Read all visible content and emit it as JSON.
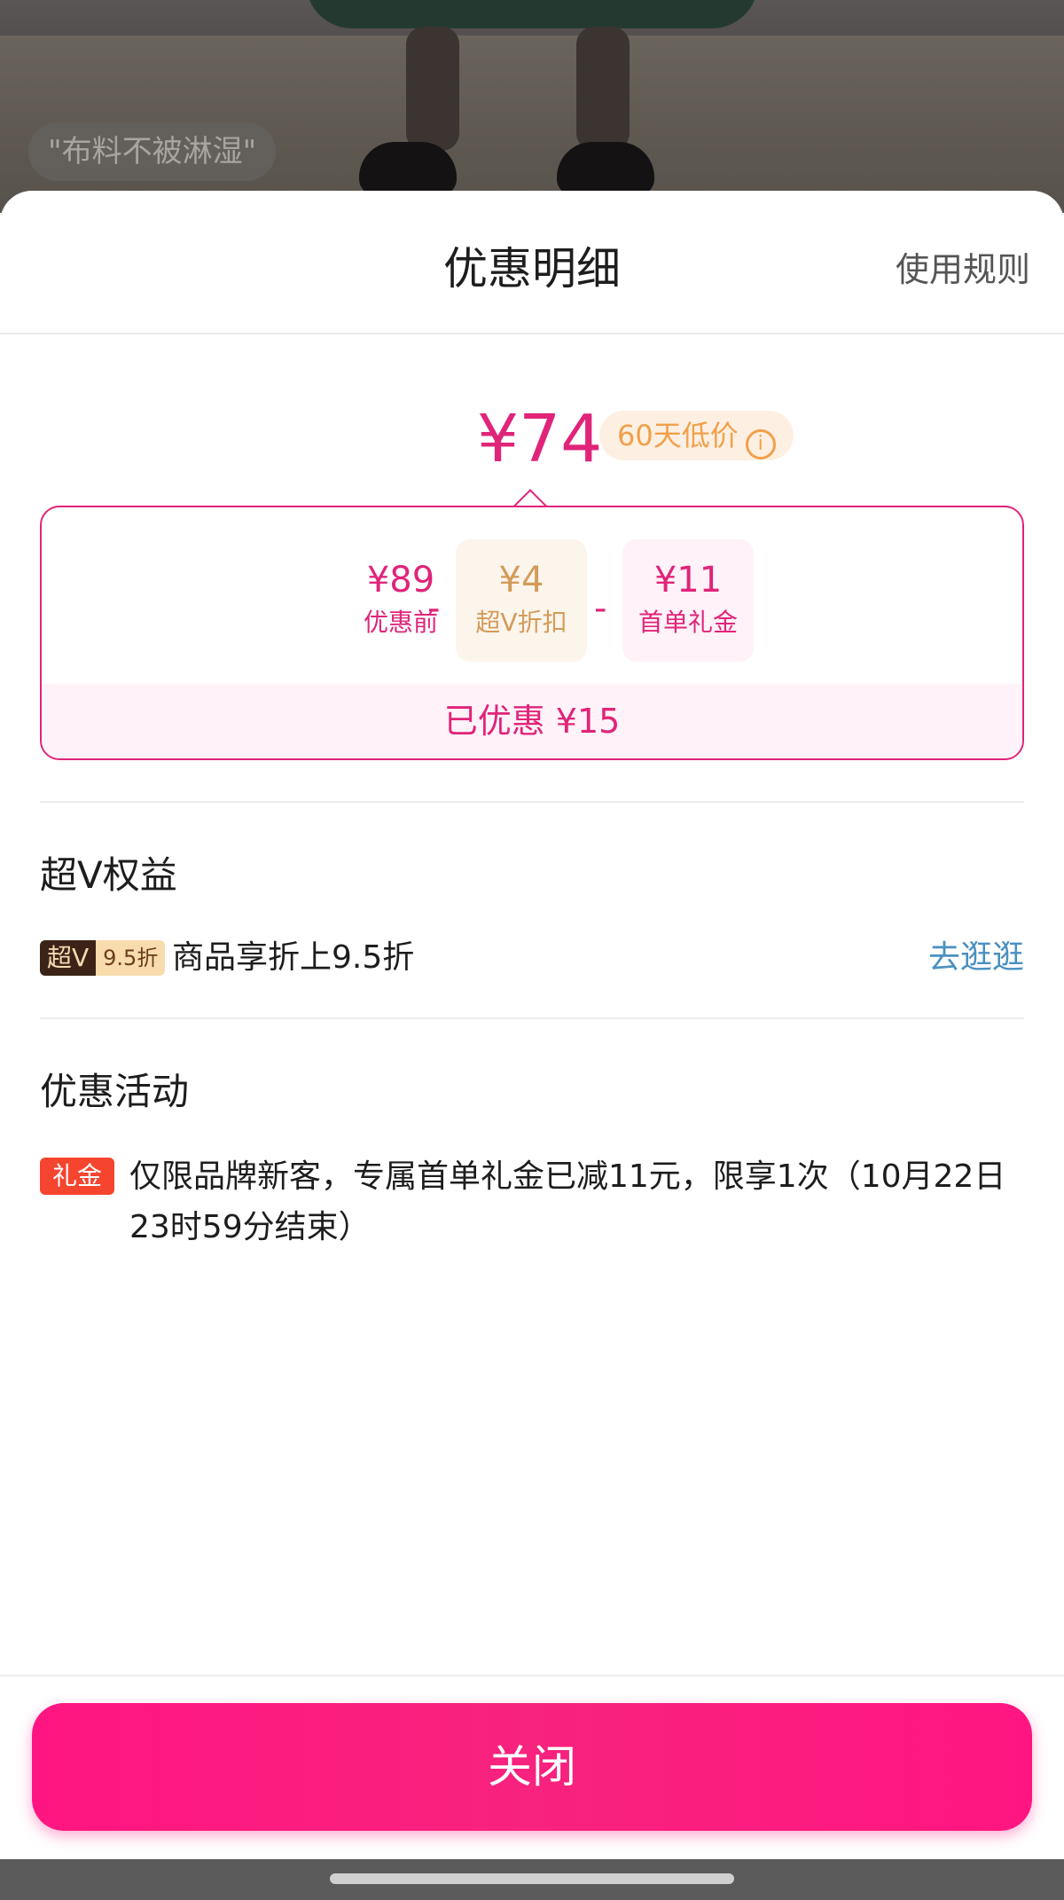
{
  "background": {
    "tag_text": "\"布料不被淋湿\""
  },
  "sheet": {
    "title": "优惠明细",
    "rules_label": "使用规则",
    "final_price": "¥74",
    "low_price_badge": "60天低价",
    "info_glyph": "i",
    "calculation": {
      "base": {
        "value": "¥89",
        "label": "优惠前"
      },
      "op1": "-",
      "superv_discount": {
        "value": "¥4",
        "label": "超V折扣"
      },
      "op2": "-",
      "first_order_gift": {
        "value": "¥11",
        "label": "首单礼金"
      },
      "total_saved": "已优惠 ¥15"
    },
    "superv_section": {
      "title": "超V权益",
      "badge_left": "超V",
      "badge_right": "9.5折",
      "description": "商品享折上9.5折",
      "link": "去逛逛"
    },
    "promotion_section": {
      "title": "优惠活动",
      "badge": "礼金",
      "description": "仅限品牌新客，专属首单礼金已减11元，限享1次（10月22日23时59分结束）"
    },
    "close_label": "关闭"
  },
  "colors": {
    "accent_pink": "#e0247a",
    "button_pink": "#ff1581",
    "superv_gold": "#d49b58",
    "link_blue": "#4a90c2",
    "gift_red": "#f5452f"
  }
}
